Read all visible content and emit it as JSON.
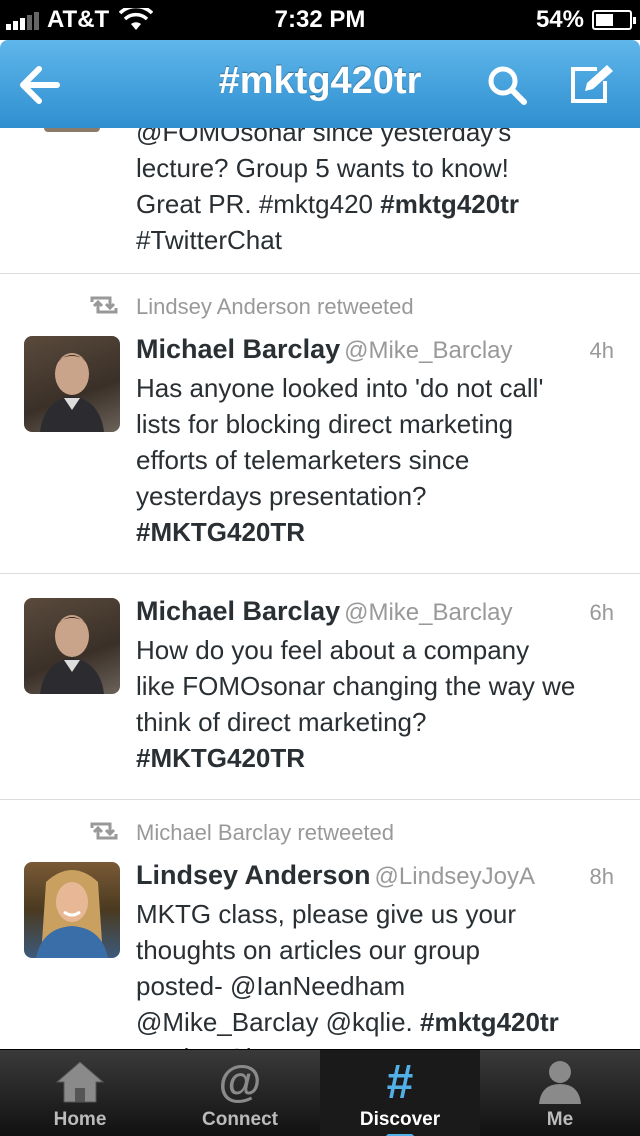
{
  "status_bar": {
    "carrier": "AT&T",
    "time": "7:32 PM",
    "battery": "54%",
    "battery_level": 0.54
  },
  "nav": {
    "title": "#mktg420tr",
    "back_icon": "back-arrow-icon",
    "search_icon": "search-icon",
    "compose_icon": "compose-icon"
  },
  "tweets": [
    {
      "text_lines": [
        "@FOMOsonar since yesterday's",
        "lecture? Group 5 wants to know!",
        "Great PR. #mktg420 ",
        "#mktg420tr",
        "#TwitterChat"
      ]
    },
    {
      "retweeted_by": "Lindsey Anderson retweeted",
      "name": "Michael Barclay",
      "handle": "@Mike_Barclay",
      "time": "4h",
      "text_lines": [
        "Has anyone looked into 'do not call'",
        "lists for blocking direct marketing",
        "efforts of telemarketers since",
        "yesterdays presentation?",
        "#MKTG420TR"
      ]
    },
    {
      "name": "Michael Barclay",
      "handle": "@Mike_Barclay",
      "time": "6h",
      "text_lines": [
        "How do you feel about a company",
        "like FOMOsonar changing the way we",
        "think of direct marketing?",
        "#MKTG420TR"
      ]
    },
    {
      "retweeted_by": "Michael Barclay retweeted",
      "name": "Lindsey Anderson",
      "handle": "@LindseyJoyA",
      "time": "8h",
      "text_lines": [
        "MKTG class, please give us your",
        "thoughts on articles our group",
        "posted- @IanNeedham",
        "@Mike_Barclay @kqlie. ",
        "#mktg420tr",
        "#TwitterChat"
      ]
    }
  ],
  "tabs": [
    {
      "label": "Home",
      "icon": "home-icon"
    },
    {
      "label": "Connect",
      "icon": "at-icon"
    },
    {
      "label": "Discover",
      "icon": "hashtag-icon",
      "active": true
    },
    {
      "label": "Me",
      "icon": "person-icon"
    }
  ],
  "colors": {
    "nav_blue": "#2f8fd0",
    "text": "#292f33",
    "muted": "#999999",
    "accent": "#53b0e6"
  }
}
